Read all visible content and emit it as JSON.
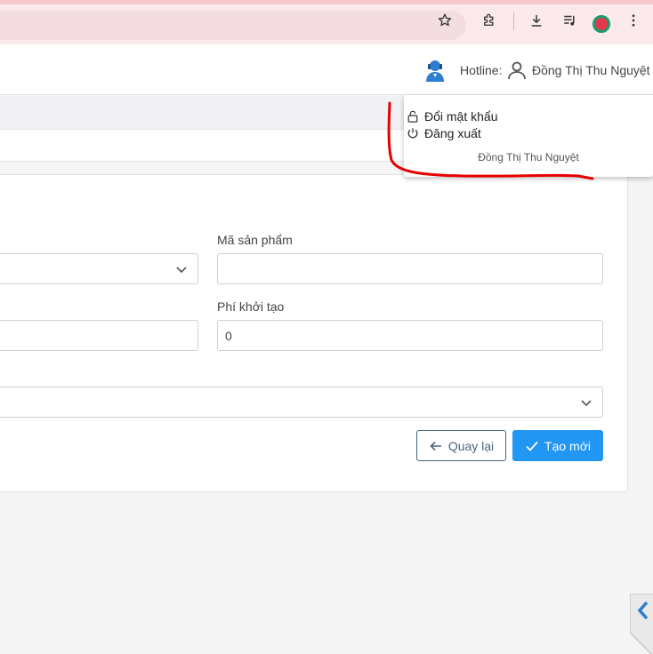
{
  "browser": {
    "icons": [
      "star-icon",
      "extension-icon",
      "download-icon",
      "media-icon",
      "profile-avatar",
      "more-icon"
    ],
    "avatar_color": "#e23a4a"
  },
  "header": {
    "hotline_label": "Hotline:",
    "username": "Đồng Thị Thu Nguyệt"
  },
  "dropdown": {
    "change_password": "Đổi mật khẩu",
    "logout": "Đăng xuất",
    "username": "Đồng Thị Thu Nguyệt"
  },
  "form": {
    "product_code_label": "Mã sản phẩm",
    "product_code_value": "",
    "setup_fee_label": "Phí khởi tạo",
    "setup_fee_value": "0",
    "back_label": "Quay lại",
    "create_label": "Tạo mới"
  },
  "colors": {
    "primary": "#2196f3",
    "back_border": "#4a6580",
    "annotation": "#e60000"
  }
}
